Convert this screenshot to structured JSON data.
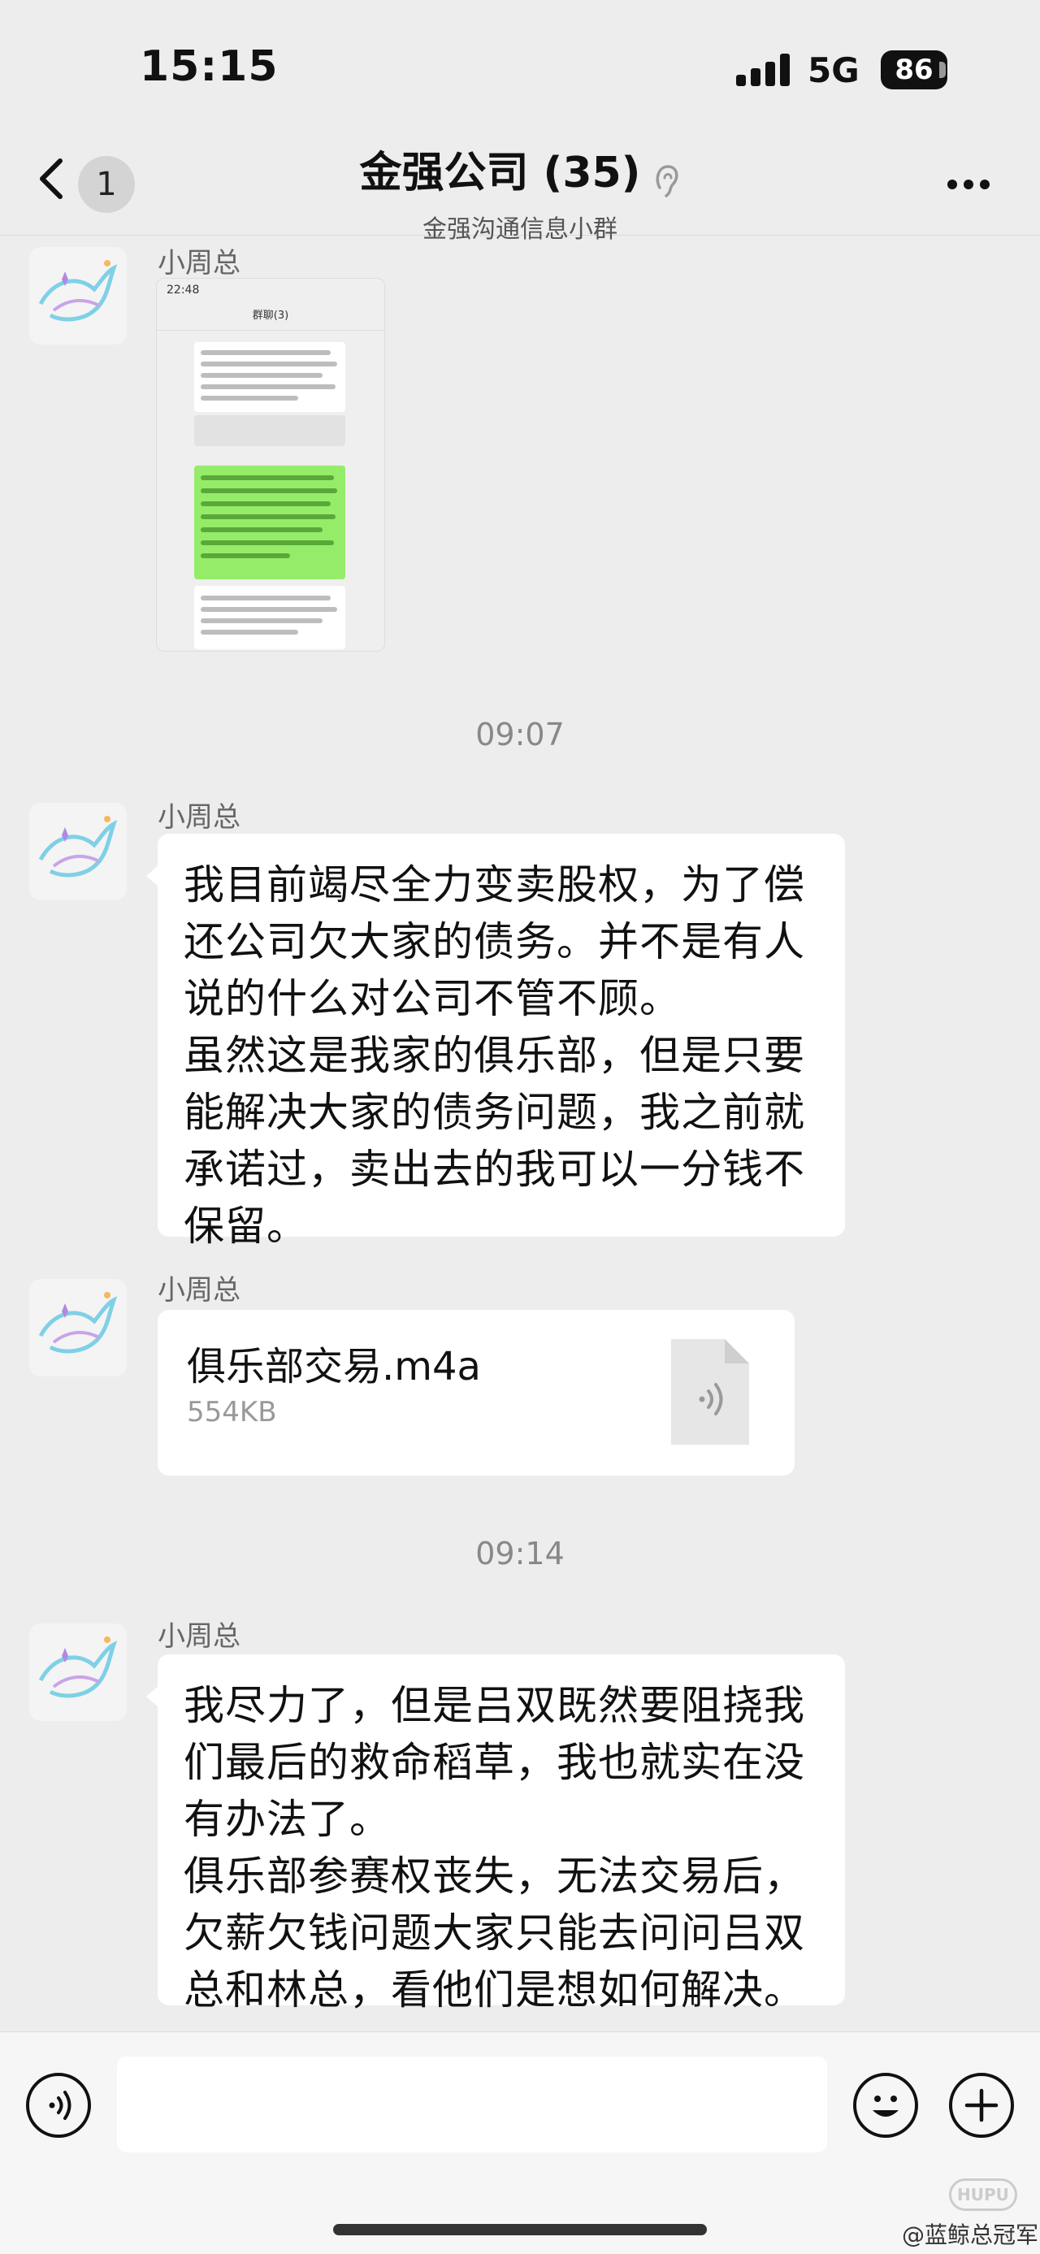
{
  "status": {
    "time": "15:15",
    "network": "5G",
    "battery": "86"
  },
  "nav": {
    "unread": "1",
    "title": "金强公司 (35)",
    "subtitle": "金强沟通信息小群"
  },
  "messages": [
    {
      "sender": "小周总"
    },
    {
      "sender": "小周总",
      "text": "我目前竭尽全力变卖股权，为了偿\n还公司欠大家的债务。并不是有人\n说的什么对公司不管不顾。\n虽然这是我家的俱乐部，但是只要\n能解决大家的债务问题，我之前就\n承诺过，卖出去的我可以一分钱不\n保留。"
    },
    {
      "sender": "小周总",
      "file_name": "俱乐部交易.m4a",
      "file_size": "554KB"
    },
    {
      "sender": "小周总",
      "text": "我尽力了，但是吕双既然要阻挠我\n们最后的救命稻草，我也就实在没\n有办法了。\n俱乐部参赛权丧失，无法交易后，\n欠薪欠钱问题大家只能去问问吕双\n总和林总，看他们是想如何解决。"
    }
  ],
  "timestamps": [
    "09:07",
    "09:14"
  ],
  "thumb": {
    "time": "22:48",
    "title": "群聊(3)"
  },
  "watermark": {
    "pill": "HUPU",
    "text": "@蓝鲸总冠军"
  },
  "icons": [
    "back-chevron-icon",
    "ear-icon",
    "more-icon",
    "avatar-whale-icon",
    "audio-file-icon",
    "voice-icon",
    "emoji-icon",
    "plus-icon"
  ]
}
